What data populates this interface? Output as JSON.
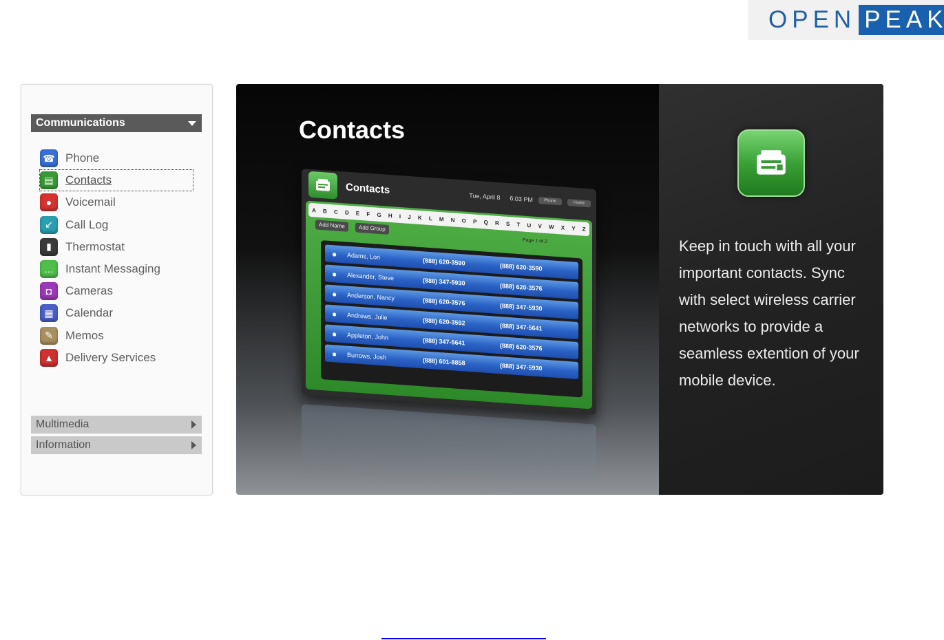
{
  "logo": {
    "open": "OPEN",
    "peak": "PEAK"
  },
  "sidebar": {
    "active_section": "Communications",
    "items": [
      {
        "label": "Phone",
        "icon": "phone-icon",
        "color": "#3a6fd8",
        "glyph": "☎"
      },
      {
        "label": "Contacts",
        "icon": "contacts-icon",
        "color": "#3a9a36",
        "glyph": "▤"
      },
      {
        "label": "Voicemail",
        "icon": "voicemail-icon",
        "color": "#d63232",
        "glyph": "●"
      },
      {
        "label": "Call Log",
        "icon": "call-log-icon",
        "color": "#2a9fb0",
        "glyph": "↙"
      },
      {
        "label": "Thermostat",
        "icon": "thermostat-icon",
        "color": "#3a3a3a",
        "glyph": "▮"
      },
      {
        "label": "Instant Messaging",
        "icon": "instant-messaging-icon",
        "color": "#4fbf4a",
        "glyph": "…"
      },
      {
        "label": "Cameras",
        "icon": "cameras-icon",
        "color": "#9a3ab8",
        "glyph": "◘"
      },
      {
        "label": "Calendar",
        "icon": "calendar-icon",
        "color": "#4a5fc8",
        "glyph": "▦"
      },
      {
        "label": "Memos",
        "icon": "memos-icon",
        "color": "#a89060",
        "glyph": "✎"
      },
      {
        "label": "Delivery Services",
        "icon": "delivery-services-icon",
        "color": "#d03030",
        "glyph": "▲"
      }
    ],
    "selected": "Contacts",
    "sections": [
      "Multimedia",
      "Information"
    ]
  },
  "hero": {
    "title": "Contacts",
    "description": "Keep in touch with all your important contacts.  Sync with select wireless carrier networks to provide a seamless extention of your mobile device.",
    "device": {
      "title": "Contacts",
      "date": "Tue, April 8",
      "time": "6:03 PM",
      "buttons": [
        "Phone",
        "Home"
      ],
      "alphabet": [
        "A",
        "B",
        "C",
        "D",
        "E",
        "F",
        "G",
        "H",
        "I",
        "J",
        "K",
        "L",
        "M",
        "N",
        "O",
        "P",
        "Q",
        "R",
        "S",
        "T",
        "U",
        "V",
        "W",
        "X",
        "Y",
        "Z"
      ],
      "add_name": "Add Name",
      "add_group": "Add Group",
      "page": "Page 1 of 2",
      "contacts": [
        {
          "name": "Adams, Lori",
          "phone1": "(888) 620-3590",
          "phone2": "(888) 620-3590"
        },
        {
          "name": "Alexander, Steve",
          "phone1": "(888) 347-5930",
          "phone2": "(888) 620-3576"
        },
        {
          "name": "Anderson, Nancy",
          "phone1": "(888) 620-3576",
          "phone2": "(888) 347-5930"
        },
        {
          "name": "Andrews, Julie",
          "phone1": "(888) 620-3592",
          "phone2": "(888) 347-5641"
        },
        {
          "name": "Appleton, John",
          "phone1": "(888) 347-5641",
          "phone2": "(888) 620-3576"
        },
        {
          "name": "Burrows, Josh",
          "phone1": "(888) 601-8858",
          "phone2": "(888) 347-5930"
        }
      ]
    }
  }
}
